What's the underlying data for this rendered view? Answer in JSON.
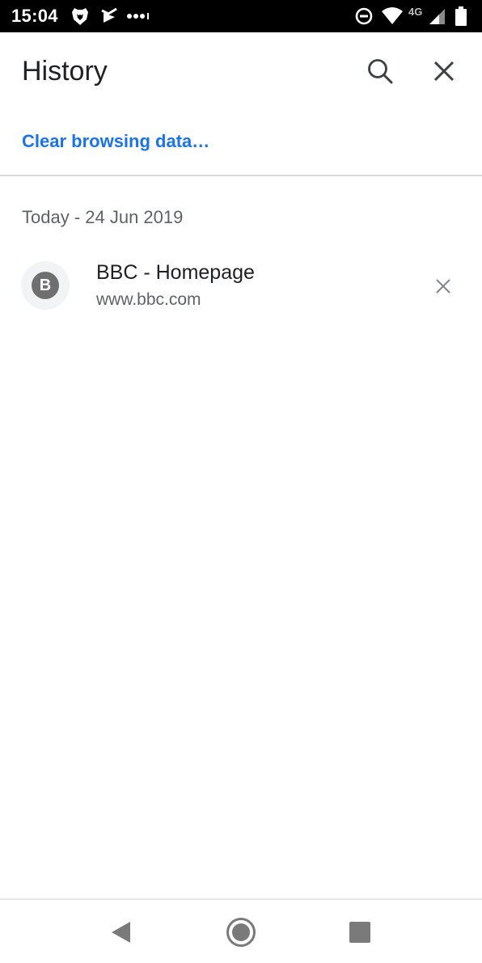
{
  "status_bar": {
    "time": "15:04",
    "network": "4G",
    "icons": [
      "brave-lion-icon",
      "vpn-check-icon",
      "more-dots-icon",
      "do-not-disturb-icon",
      "wifi-icon",
      "signal-icon",
      "battery-icon"
    ]
  },
  "header": {
    "title": "History",
    "search_icon": "search-icon",
    "close_icon": "close-icon"
  },
  "actions": {
    "clear_browsing_data": "Clear browsing data…"
  },
  "history": {
    "section_header": "Today - 24 Jun 2019",
    "items": [
      {
        "favicon_letter": "B",
        "title": "BBC - Homepage",
        "url": "www.bbc.com",
        "remove_icon": "remove-icon"
      }
    ]
  },
  "nav_bar": {
    "icons": [
      "back-icon",
      "home-icon",
      "recents-icon"
    ]
  },
  "colors": {
    "accent": "#1a73e8",
    "text_primary": "#202124",
    "text_secondary": "#5f6368",
    "divider": "#dadce0",
    "status_bar": "#000000"
  }
}
